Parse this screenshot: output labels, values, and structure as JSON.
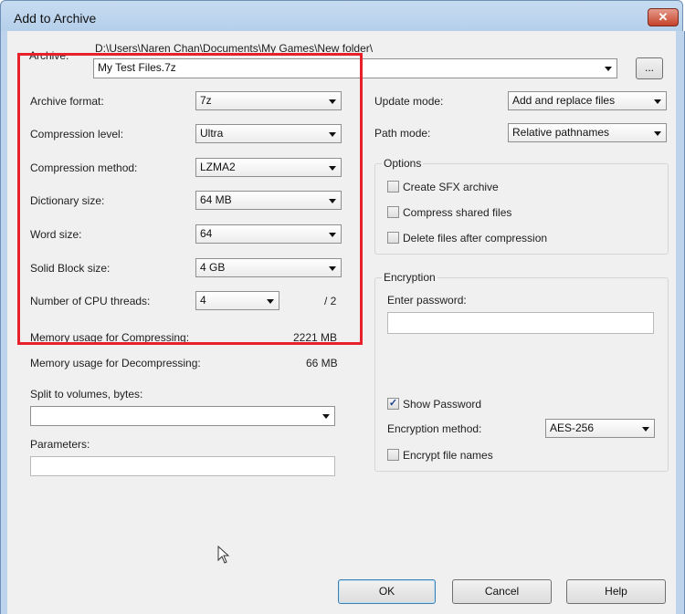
{
  "window": {
    "title": "Add to Archive",
    "close_glyph": "✕"
  },
  "archive": {
    "label": "Archive:",
    "path": "D:\\Users\\Naren Chan\\Documents\\My Games\\New folder\\",
    "filename": "My Test Files.7z",
    "browse_label": "..."
  },
  "settings": {
    "archive_format": {
      "label": "Archive format:",
      "value": "7z"
    },
    "compression_level": {
      "label": "Compression level:",
      "value": "Ultra"
    },
    "compression_method": {
      "label": "Compression method:",
      "value": "LZMA2"
    },
    "dictionary_size": {
      "label": "Dictionary size:",
      "value": "64 MB"
    },
    "word_size": {
      "label": "Word size:",
      "value": "64"
    },
    "solid_block_size": {
      "label": "Solid Block size:",
      "value": "4 GB"
    },
    "cpu_threads": {
      "label": "Number of CPU threads:",
      "value": "4",
      "max": "/ 2"
    },
    "memory_compress": {
      "label": "Memory usage for Compressing:",
      "value": "2221 MB"
    },
    "memory_decompress": {
      "label": "Memory usage for Decompressing:",
      "value": "66 MB"
    }
  },
  "split": {
    "label": "Split to volumes, bytes:",
    "value": ""
  },
  "parameters": {
    "label": "Parameters:",
    "value": ""
  },
  "update_mode": {
    "label": "Update mode:",
    "value": "Add and replace files"
  },
  "path_mode": {
    "label": "Path mode:",
    "value": "Relative pathnames"
  },
  "options": {
    "title": "Options",
    "items": [
      {
        "label": "Create SFX archive",
        "checked": false
      },
      {
        "label": "Compress shared files",
        "checked": false
      },
      {
        "label": "Delete files after compression",
        "checked": false
      }
    ]
  },
  "encryption": {
    "title": "Encryption",
    "password_label": "Enter password:",
    "password_value": "",
    "show_password": {
      "label": "Show Password",
      "checked": true
    },
    "method_label": "Encryption method:",
    "method_value": "AES-256",
    "encrypt_names": {
      "label": "Encrypt file names",
      "checked": false
    }
  },
  "buttons": {
    "ok": "OK",
    "cancel": "Cancel",
    "help": "Help"
  },
  "highlight_color": "#e8202a",
  "check_glyph": "✓"
}
